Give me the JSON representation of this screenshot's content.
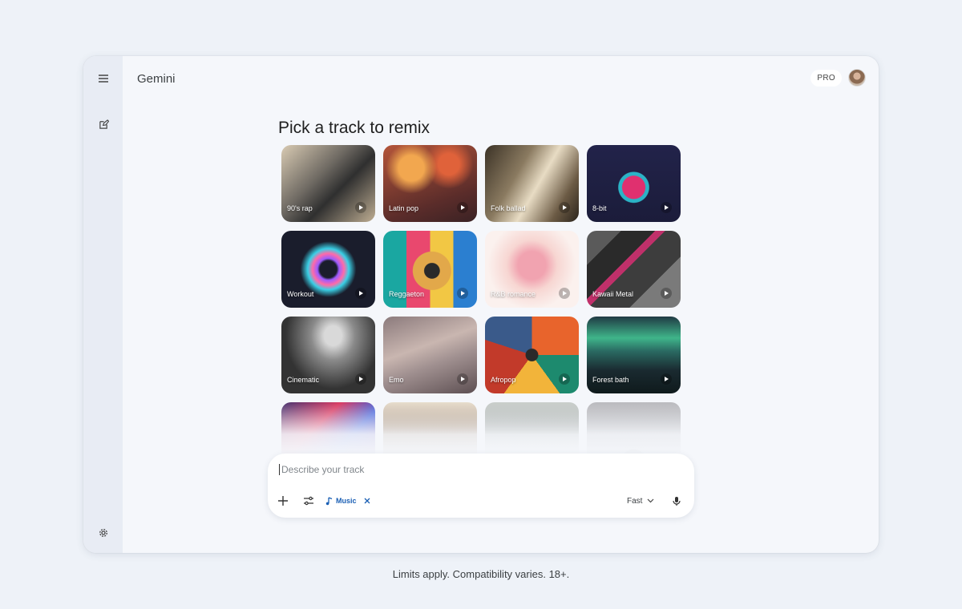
{
  "app": {
    "title": "Gemini",
    "plan_badge": "PRO"
  },
  "sidebar": {
    "menu_icon": "hamburger-menu-icon",
    "new_chat_icon": "edit-icon",
    "settings_icon": "gear-icon"
  },
  "main": {
    "heading": "Pick a track to remix",
    "tracks": [
      {
        "label": "90's rap"
      },
      {
        "label": "Latin pop"
      },
      {
        "label": "Folk ballad"
      },
      {
        "label": "8-bit"
      },
      {
        "label": "Workout"
      },
      {
        "label": "Reggaeton"
      },
      {
        "label": "R&B romance"
      },
      {
        "label": "Kawaii Metal"
      },
      {
        "label": "Cinematic"
      },
      {
        "label": "Emo"
      },
      {
        "label": "Afropop"
      },
      {
        "label": "Forest bath"
      },
      {
        "label": ""
      },
      {
        "label": ""
      },
      {
        "label": ""
      },
      {
        "label": ""
      }
    ]
  },
  "composer": {
    "placeholder": "Describe your track",
    "chip_label": "Music",
    "model_label": "Fast"
  },
  "footer": {
    "text": "Limits apply. Compatibility varies. 18+."
  },
  "colors": {
    "accent": "#1a5fb4",
    "page_bg": "#eef2f8"
  }
}
